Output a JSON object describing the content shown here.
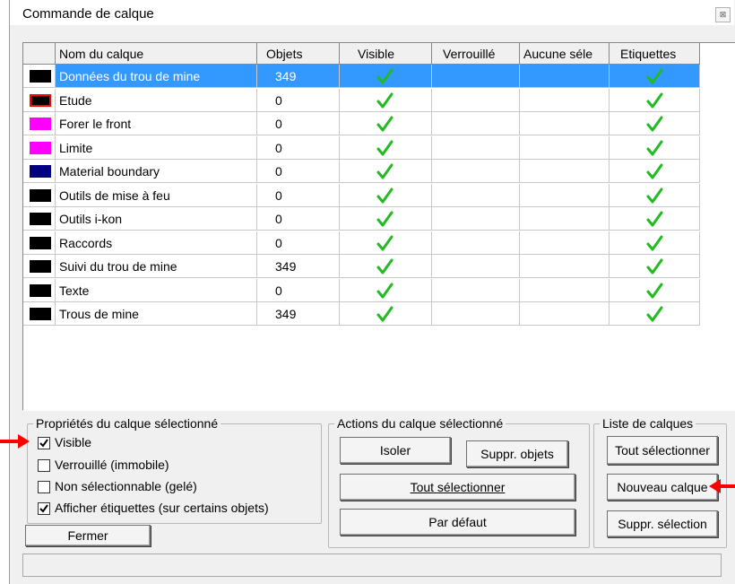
{
  "window": {
    "title": "Commande de calque",
    "close_glyph": "⊠"
  },
  "table": {
    "columns": [
      "Nom du calque",
      "Objets",
      "Visible",
      "Verrouillé",
      "Aucune séle",
      "Etiquettes"
    ],
    "rows": [
      {
        "color": "#000000",
        "name": "Données du trou de mine",
        "objets": "349",
        "visible": true,
        "verrouille": false,
        "aucune": false,
        "etiquettes": true,
        "selected": true
      },
      {
        "color": "#000000",
        "name": "Etude",
        "objets": "0",
        "visible": true,
        "verrouille": false,
        "aucune": false,
        "etiquettes": true,
        "border_color": "#ff0000"
      },
      {
        "color": "#ff00ff",
        "name": "Forer le front",
        "objets": "0",
        "visible": true,
        "verrouille": false,
        "aucune": false,
        "etiquettes": true
      },
      {
        "color": "#ff00ff",
        "name": "Limite",
        "objets": "0",
        "visible": true,
        "verrouille": false,
        "aucune": false,
        "etiquettes": true
      },
      {
        "color": "#000080",
        "name": "Material boundary",
        "objets": "0",
        "visible": true,
        "verrouille": false,
        "aucune": false,
        "etiquettes": true
      },
      {
        "color": "#000000",
        "name": "Outils de mise à feu",
        "objets": "0",
        "visible": true,
        "verrouille": false,
        "aucune": false,
        "etiquettes": true
      },
      {
        "color": "#000000",
        "name": "Outils i-kon",
        "objets": "0",
        "visible": true,
        "verrouille": false,
        "aucune": false,
        "etiquettes": true
      },
      {
        "color": "#000000",
        "name": "Raccords",
        "objets": "0",
        "visible": true,
        "verrouille": false,
        "aucune": false,
        "etiquettes": true
      },
      {
        "color": "#000000",
        "name": "Suivi du trou de mine",
        "objets": "349",
        "visible": true,
        "verrouille": false,
        "aucune": false,
        "etiquettes": true
      },
      {
        "color": "#000000",
        "name": "Texte",
        "objets": "0",
        "visible": true,
        "verrouille": false,
        "aucune": false,
        "etiquettes": true
      },
      {
        "color": "#000000",
        "name": "Trous de mine",
        "objets": "349",
        "visible": true,
        "verrouille": false,
        "aucune": false,
        "etiquettes": true
      }
    ]
  },
  "props": {
    "title": "Propriétés du calque sélectionné",
    "visible": {
      "label": "Visible",
      "checked": true
    },
    "locked": {
      "label": "Verrouillé (immobile)",
      "checked": false
    },
    "nonselectable": {
      "label": "Non sélectionnable (gelé)",
      "checked": false
    },
    "labels": {
      "label": "Afficher étiquettes (sur certains objets)",
      "checked": true
    },
    "close_button": "Fermer"
  },
  "actions": {
    "title": "Actions du calque sélectionné",
    "isolate": "Isoler",
    "delete_objects": "Suppr. objets",
    "select_all": "Tout sélectionner",
    "default": "Par défaut"
  },
  "list": {
    "title": "Liste de calques",
    "select_all": "Tout sélectionner",
    "new_layer": "Nouveau calque",
    "delete_selection": "Suppr. sélection"
  },
  "colors": {
    "selection": "#3399ff",
    "check": "#22bb22",
    "annotation_arrow": "#ff0000"
  }
}
